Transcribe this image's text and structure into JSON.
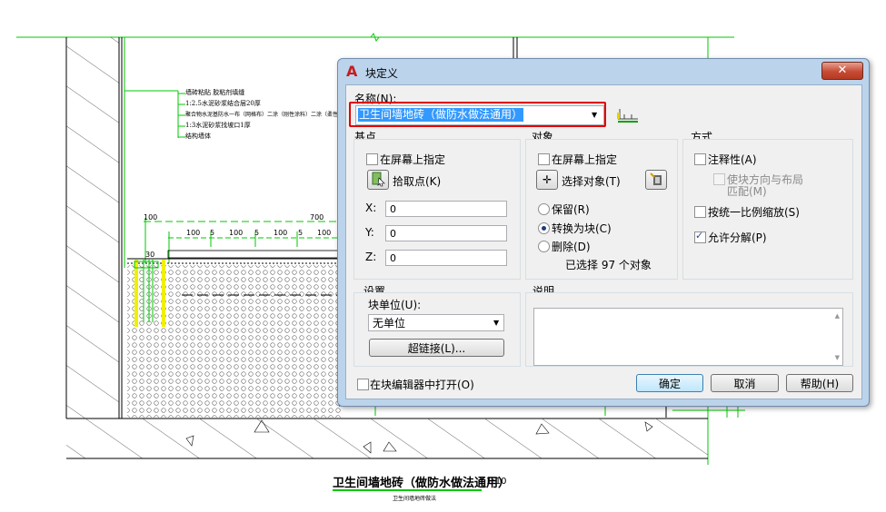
{
  "drawing": {
    "layer_notes": [
      "墙砖粘贴 胶粘剂填缝",
      "1:2.5水泥砂浆结合层20厚",
      "聚合物水泥基防水一布（网格布）二涂（刚性涂料）二涂（柔性涂料）1.5厚",
      "1:3水泥砂浆找坡口1厚",
      "结构墙体"
    ],
    "dims_top": [
      "100",
      "700"
    ],
    "dims_sub": [
      "100",
      "5",
      "100",
      "5",
      "100",
      "5",
      "100"
    ],
    "dim_left": "30",
    "caption_title": "卫生间墙地砖（做防水做法通用）",
    "caption_scale": "1:10",
    "caption_sub": "卫生间墙地砖做法"
  },
  "dialog": {
    "title": "块定义",
    "close_label": "✕",
    "name_label": "名称(N):",
    "name_value": "卫生间墙地砖（做防水做法通用）",
    "basepoint": {
      "title": "基点",
      "specify_on_screen": "在屏幕上指定",
      "pick_point": "拾取点(K)",
      "x_label": "X:",
      "x_value": "0",
      "y_label": "Y:",
      "y_value": "0",
      "z_label": "Z:",
      "z_value": "0"
    },
    "objects": {
      "title": "对象",
      "specify_on_screen": "在屏幕上指定",
      "select_objects": "选择对象(T)",
      "retain": "保留(R)",
      "convert": "转换为块(C)",
      "delete": "删除(D)",
      "selected_count": "已选择 97 个对象"
    },
    "behavior": {
      "title": "方式",
      "annotative": "注释性(A)",
      "match_orientation": "使块方向与布局",
      "match_orientation_2": "匹配(M)",
      "scale_uniformly": "按统一比例缩放(S)",
      "allow_explode": "允许分解(P)"
    },
    "settings": {
      "title": "设置",
      "block_unit_label": "块单位(U):",
      "block_unit_value": "无单位",
      "hyperlink": "超链接(L)..."
    },
    "description": {
      "title": "说明"
    },
    "open_in_editor": "在块编辑器中打开(O)",
    "ok": "确定",
    "cancel": "取消",
    "help": "帮助(H)"
  },
  "colors": {
    "cad_green": "#00c800",
    "cad_yellow": "#f0f000",
    "highlight_red": "#e10000",
    "selection_blue": "#3399ff",
    "dialog_frame": "#bcd3ec"
  }
}
